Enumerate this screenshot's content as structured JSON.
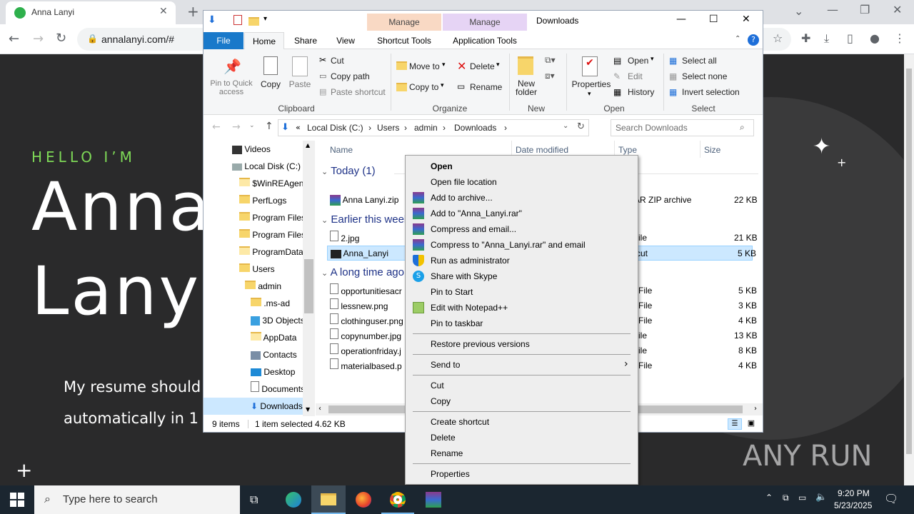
{
  "browser": {
    "tab_title": "Anna Lanyi",
    "url": "annalanyi.com/#",
    "new_tab": "+"
  },
  "site": {
    "hello": "HELLO I’M",
    "name_line1": "Anna",
    "name_line2": "Lanyi",
    "tagline1": "My resume should",
    "tagline2": "automatically in 1",
    "watermark": "ANY RUN"
  },
  "explorer": {
    "title": "Downloads",
    "manage1": "Manage",
    "manage2": "Manage",
    "tabs": [
      "File",
      "Home",
      "Share",
      "View",
      "Shortcut Tools",
      "Application Tools"
    ],
    "ribbon": {
      "pin": "Pin to Quick access",
      "copy": "Copy",
      "paste": "Paste",
      "cut": "Cut",
      "copy_path": "Copy path",
      "paste_shortcut": "Paste shortcut",
      "move_to": "Move to",
      "copy_to": "Copy to",
      "delete": "Delete",
      "rename": "Rename",
      "new_folder": "New folder",
      "properties": "Properties",
      "open": "Open",
      "edit": "Edit",
      "history": "History",
      "select_all": "Select all",
      "select_none": "Select none",
      "invert": "Invert selection",
      "groups": [
        "Clipboard",
        "Organize",
        "New",
        "Open",
        "Select"
      ]
    },
    "breadcrumb": [
      "Local Disk (C:)",
      "Users",
      "admin",
      "Downloads"
    ],
    "search_placeholder": "Search Downloads",
    "nav": [
      "Videos",
      "Local Disk (C:)",
      "$WinREAgent",
      "PerfLogs",
      "Program Files",
      "Program Files",
      "ProgramData",
      "Users",
      "admin",
      ".ms-ad",
      "3D Objects",
      "AppData",
      "Contacts",
      "Desktop",
      "Documents",
      "Downloads"
    ],
    "columns": [
      "Name",
      "Date modified",
      "Type",
      "Size"
    ],
    "groups": [
      "Today (1)",
      "Earlier this week",
      "A long time ago"
    ],
    "files": [
      {
        "name": "Anna Lanyi.zip",
        "type": "AR ZIP archive",
        "size": "22 KB"
      },
      {
        "name": "2.jpg",
        "type": "ile",
        "size": "21 KB"
      },
      {
        "name": "Anna_Lanyi",
        "type": "cut",
        "size": "5 KB"
      },
      {
        "name": "opportunitiesacr",
        "type": "File",
        "size": "5 KB"
      },
      {
        "name": "lessnew.png",
        "type": "File",
        "size": "3 KB"
      },
      {
        "name": "clothinguser.png",
        "type": "File",
        "size": "4 KB"
      },
      {
        "name": "copynumber.jpg",
        "type": "ile",
        "size": "13 KB"
      },
      {
        "name": "operationfriday.j",
        "type": "ile",
        "size": "8 KB"
      },
      {
        "name": "materialbased.p",
        "type": "File",
        "size": "4 KB"
      }
    ],
    "status_items": "9 items",
    "status_selected": "1 item selected",
    "status_size": "4.62 KB"
  },
  "context_menu": [
    "Open",
    "Open file location",
    "Add to archive...",
    "Add to \"Anna_Lanyi.rar\"",
    "Compress and email...",
    "Compress to \"Anna_Lanyi.rar\" and email",
    "Run as administrator",
    "Share with Skype",
    "Pin to Start",
    "Edit with Notepad++",
    "Pin to taskbar",
    "Restore previous versions",
    "Send to",
    "Cut",
    "Copy",
    "Create shortcut",
    "Delete",
    "Rename",
    "Properties"
  ],
  "taskbar": {
    "search": "Type here to search",
    "time": "9:20 PM",
    "date": "5/23/2025"
  }
}
